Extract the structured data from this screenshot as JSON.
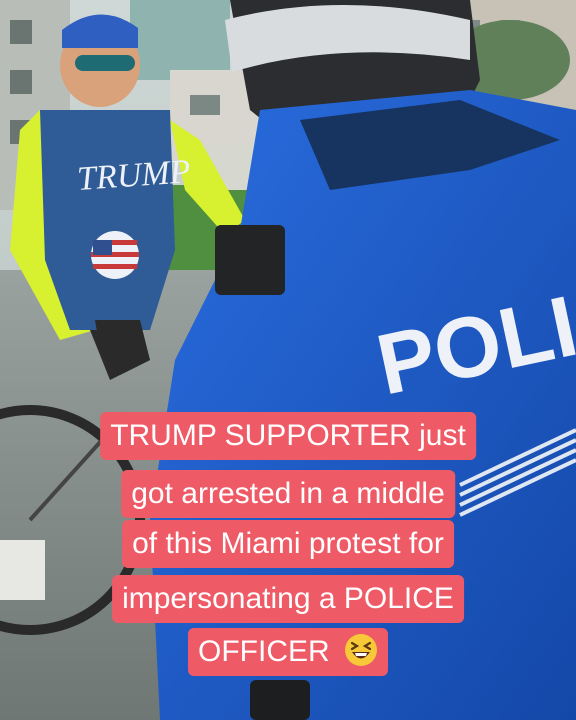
{
  "scene": {
    "shirt_text": "TRUMP",
    "back_text": "POLIC"
  },
  "caption": {
    "lines": [
      "TRUMP SUPPORTER just",
      "got arrested in a middle",
      "of this Miami protest for",
      "impersonating a POLICE",
      "OFFICER"
    ],
    "emoji": "laughing-squinting-face-icon"
  },
  "colors": {
    "caption_bg": "#ee5b66",
    "caption_text": "#ffffff",
    "police_shirt": "#1f5fd0",
    "neon_sleeve": "#d7f030"
  }
}
